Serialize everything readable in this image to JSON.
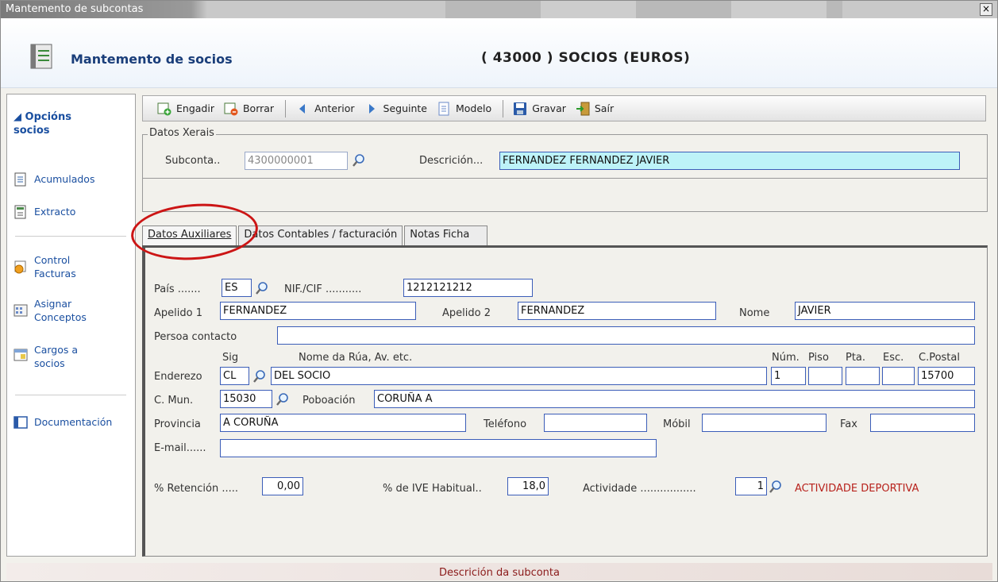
{
  "window": {
    "title": "Mantemento de subcontas",
    "close_label": "×"
  },
  "header": {
    "title": "Mantemento de socios",
    "account": "( 43000 ) SOCIOS (EUROS)"
  },
  "sidebar": {
    "section_title_1": "◢ Opcións",
    "section_title_2": "socios",
    "items": [
      {
        "label": "Acumulados",
        "icon": "document-icon"
      },
      {
        "label": "Extracto",
        "icon": "document-icon"
      },
      {
        "label": "Control\nFacturas",
        "icon": "invoice-icon"
      },
      {
        "label": "Asignar\nConceptos",
        "icon": "grid-icon"
      },
      {
        "label": "Cargos a\nsocios",
        "icon": "calendar-icon"
      },
      {
        "label": "Documentación",
        "icon": "window-icon"
      }
    ]
  },
  "toolbar": {
    "add": "Engadir",
    "delete": "Borrar",
    "prev": "Anterior",
    "next": "Seguinte",
    "template": "Modelo",
    "save": "Gravar",
    "exit": "Saír"
  },
  "general": {
    "legend": "Datos Xerais",
    "subaccount_label": "Subconta..",
    "subaccount_value": "4300000001",
    "description_label": "Descrición...",
    "description_value": "FERNANDEZ FERNANDEZ JAVIER"
  },
  "tabs": {
    "t1": "Datos Auxiliares",
    "t2": "Datos Contables / facturación",
    "t3": "Notas Ficha"
  },
  "form": {
    "country_label": "País .......",
    "country_value": "ES",
    "nif_label": "NIF./CIF ...........",
    "nif_value": "1212121212",
    "surname1_label": "Apelido 1",
    "surname1_value": "FERNANDEZ",
    "surname2_label": "Apelido 2",
    "surname2_value": "FERNANDEZ",
    "name_label": "Nome",
    "name_value": "JAVIER",
    "contact_label": "Persoa contacto",
    "contact_value": "",
    "sig_label": "Sig",
    "street_label": "Nome da Rúa, Av. etc.",
    "num_label": "Núm.",
    "floor_label": "Piso",
    "door_label": "Pta.",
    "stair_label": "Esc.",
    "postal_label": "C.Postal",
    "address_label": "Enderezo",
    "sig_value": "CL",
    "street_value": "DEL SOCIO",
    "num_value": "1",
    "floor_value": "",
    "door_value": "",
    "stair_value": "",
    "postal_value": "15700",
    "mun_label": "C. Mun.",
    "mun_value": "15030",
    "town_label": "Poboación",
    "town_value": "CORUÑA A",
    "province_label": "Provincia",
    "province_value": "A CORUÑA",
    "phone_label": "Teléfono",
    "phone_value": "",
    "mobile_label": "Móbil",
    "mobile_value": "",
    "fax_label": "Fax",
    "fax_value": "",
    "email_label": "E-mail......",
    "email_value": "",
    "retention_label": "% Retención .....",
    "retention_value": "0,00",
    "vat_label": "% de IVE Habitual..",
    "vat_value": "18,0",
    "activity_label": "Actividade .................",
    "activity_value": "1",
    "activity_desc": "ACTIVIDADE DEPORTIVA"
  },
  "status": {
    "text": "Descrición da subconta"
  }
}
